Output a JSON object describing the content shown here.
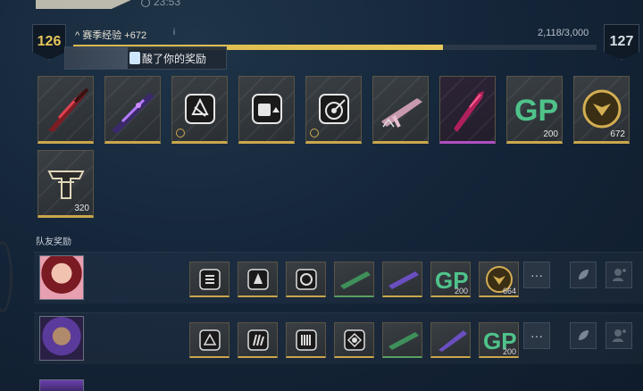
{
  "header": {
    "time": "23:53"
  },
  "level": {
    "current": "126",
    "next": "127",
    "xp_label": "赛季经验 +672",
    "xp_count": "2,118/3,000",
    "progress": 0.706
  },
  "toast": {
    "text": "酸了你的奖励"
  },
  "rewards": [
    {
      "name": "red-knife-skin",
      "count": "",
      "rarity": "gold"
    },
    {
      "name": "purple-knife-skin",
      "count": "",
      "rarity": "gold"
    },
    {
      "name": "badge-emblem",
      "count": "",
      "rarity": "gold"
    },
    {
      "name": "fist-upgrade-emblem",
      "count": "",
      "rarity": "gold"
    },
    {
      "name": "target-emblem",
      "count": "",
      "rarity": "gold"
    },
    {
      "name": "pink-gun-skin",
      "count": "",
      "rarity": "gold"
    },
    {
      "name": "pink-dagger-skin",
      "count": "",
      "rarity": "purple"
    },
    {
      "name": "gp-currency",
      "count": "200",
      "rarity": "gold"
    },
    {
      "name": "gold-coin",
      "count": "672",
      "rarity": "gold"
    },
    {
      "name": "t-logo-emblem",
      "count": "320",
      "rarity": "gold"
    }
  ],
  "friends": {
    "title": "队友奖励",
    "rows": [
      {
        "items": [
          {
            "name": "upgrade-emblem",
            "count": ""
          },
          {
            "name": "crystal-emblem",
            "count": ""
          },
          {
            "name": "spin-emblem",
            "count": ""
          },
          {
            "name": "green-gun-skin",
            "count": ""
          },
          {
            "name": "purple-gun-skin",
            "count": ""
          },
          {
            "name": "gp-currency",
            "count": "200"
          },
          {
            "name": "gold-coin",
            "count": "664"
          }
        ]
      },
      {
        "items": [
          {
            "name": "badge-emblem",
            "count": ""
          },
          {
            "name": "claw-emblem",
            "count": ""
          },
          {
            "name": "bars-emblem",
            "count": ""
          },
          {
            "name": "eye-emblem",
            "count": ""
          },
          {
            "name": "green-gun-skin",
            "count": ""
          },
          {
            "name": "purple-knife-skin",
            "count": ""
          },
          {
            "name": "gp-currency",
            "count": "200"
          }
        ]
      }
    ],
    "more_label": "···"
  }
}
